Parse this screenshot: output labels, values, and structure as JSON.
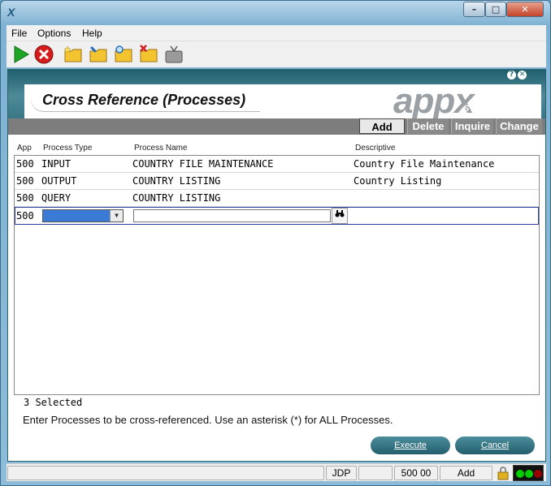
{
  "window": {
    "icon": "appx-icon",
    "min_label": "–",
    "max_label": "□",
    "close_label": "✕"
  },
  "menu": [
    {
      "label": "File"
    },
    {
      "label": "Options"
    },
    {
      "label": "Help"
    }
  ],
  "toolbar": [
    {
      "name": "play-icon"
    },
    {
      "name": "stop-icon"
    },
    {
      "name": "new-folder-icon"
    },
    {
      "name": "edit-folder-icon"
    },
    {
      "name": "search-folder-icon"
    },
    {
      "name": "delete-folder-icon"
    },
    {
      "name": "tv-icon"
    }
  ],
  "header": {
    "title": "Cross Reference (Processes)",
    "logo": "appx",
    "logo_sub": "SOFTWARE",
    "help_label": "?",
    "close_label": "✕"
  },
  "tabs": [
    {
      "label": "Add",
      "active": true
    },
    {
      "label": "Delete"
    },
    {
      "label": "Inquire"
    },
    {
      "label": "Change"
    }
  ],
  "columns": {
    "app": "App",
    "process_type": "Process Type",
    "process_name": "Process Name",
    "descriptive": "Descriptive"
  },
  "rows": [
    {
      "app": "500",
      "process_type": "INPUT",
      "process_name": "COUNTRY FILE MAINTENANCE",
      "descriptive": "Country File Maintenance"
    },
    {
      "app": "500",
      "process_type": "OUTPUT",
      "process_name": "COUNTRY LISTING",
      "descriptive": "Country Listing"
    },
    {
      "app": "500",
      "process_type": "QUERY",
      "process_name": "COUNTRY LISTING",
      "descriptive": ""
    }
  ],
  "new_row": {
    "app": "500",
    "process_type": "",
    "process_name": ""
  },
  "footer": {
    "selected": "3 Selected",
    "instructions": "Enter Processes to be cross-referenced. Use an asterisk (*) for ALL Processes.",
    "execute_label": "Execute",
    "cancel_label": "Cancel"
  },
  "status": {
    "user": "JDP",
    "blank": "",
    "app_version": "500 00",
    "mode": "Add"
  }
}
